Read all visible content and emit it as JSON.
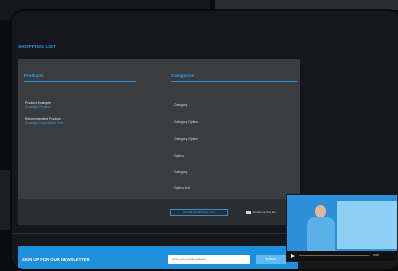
{
  "page": {
    "title": "SHOPPING LIST"
  },
  "columns": {
    "products_title": "Products",
    "categories_title": "Categories"
  },
  "products": [
    {
      "name": "Product Example",
      "sub": "Example Product"
    },
    {
      "name": "Recommended Product",
      "sub": "Example Description Text"
    }
  ],
  "categories": [
    "Category",
    "Category Option",
    "Category Option",
    "Option",
    "Category",
    "Option List"
  ],
  "footer": {
    "share_label": "SHARE SHOPPING LIST",
    "email_label": "Email me this list"
  },
  "newsletter": {
    "text": "SIGN UP FOR OUR NEWSLETTER",
    "placeholder": "Enter your email address",
    "button": "SUBMIT"
  },
  "video": {
    "time": "0:00"
  },
  "colors": {
    "accent": "#2f9fe8",
    "panel": "#3b3c3f",
    "newsletter": "#1e8fdb"
  }
}
